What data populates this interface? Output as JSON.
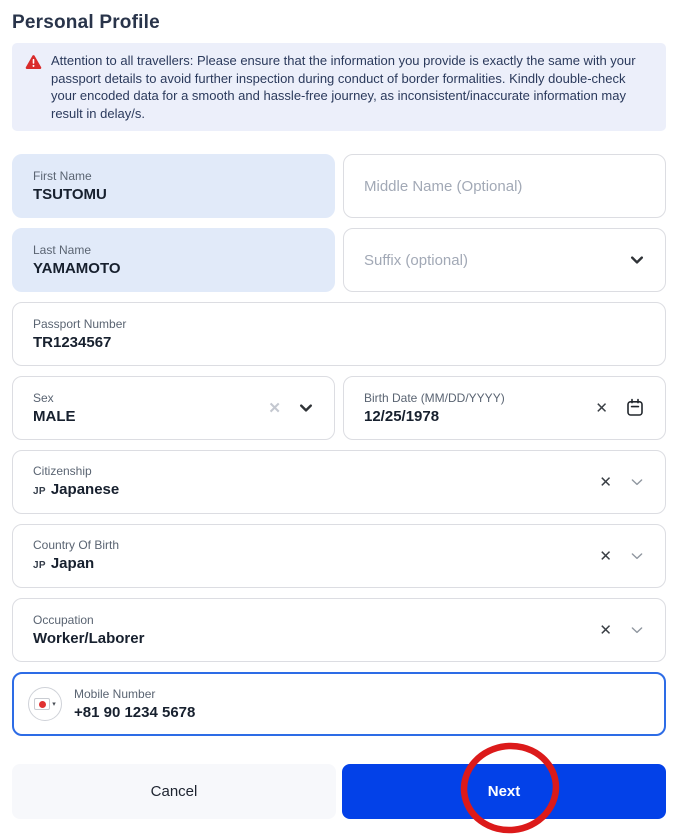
{
  "page": {
    "title": "Personal Profile"
  },
  "notice": {
    "icon": "warning-triangle",
    "text": "Attention to all travellers: Please ensure that the information you provide is exactly the same with your passport details to avoid further inspection during conduct of border formalities. Kindly double-check your encoded data for a smooth and hassle-free journey, as inconsistent/inaccurate information may result in delay/s."
  },
  "fields": {
    "first_name": {
      "label": "First Name",
      "value": "TSUTOMU"
    },
    "middle_name": {
      "placeholder": "Middle Name (Optional)"
    },
    "last_name": {
      "label": "Last Name",
      "value": "YAMAMOTO"
    },
    "suffix": {
      "placeholder": "Suffix (optional)"
    },
    "passport_number": {
      "label": "Passport Number",
      "value": "TR1234567"
    },
    "sex": {
      "label": "Sex",
      "value": "MALE"
    },
    "birth_date": {
      "label": "Birth Date (MM/DD/YYYY)",
      "value": "12/25/1978"
    },
    "citizenship": {
      "label": "Citizenship",
      "country_code": "JP",
      "value": "Japanese"
    },
    "country_of_birth": {
      "label": "Country Of Birth",
      "country_code": "JP",
      "value": "Japan"
    },
    "occupation": {
      "label": "Occupation",
      "value": "Worker/Laborer"
    },
    "mobile": {
      "label": "Mobile Number",
      "value": "+81 90 1234 5678",
      "flag": "japan-flag"
    }
  },
  "icons": {
    "clear_x": "✕",
    "flag_caret": "▾"
  },
  "buttons": {
    "cancel": "Cancel",
    "next": "Next"
  },
  "colors": {
    "accent_blue": "#0341e8",
    "focus_border": "#2d6ce6",
    "warning_red": "#d92b2b",
    "annotation_red": "#dc1a1a",
    "filled_field_bg": "#e1eaf9",
    "notice_bg": "#eceffa"
  }
}
